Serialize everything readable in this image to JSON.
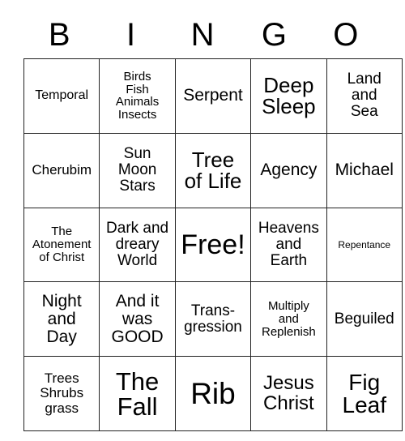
{
  "card": {
    "header_letters": [
      "B",
      "I",
      "N",
      "G",
      "O"
    ],
    "free_space_label": "Free!",
    "grid": [
      [
        {
          "text": "Temporal",
          "size": "fs-sm",
          "free": false
        },
        {
          "text": "Birds\nFish\nAnimals\nInsects",
          "size": "fs-s",
          "free": false
        },
        {
          "text": "Serpent",
          "size": "fs-l",
          "free": false
        },
        {
          "text": "Deep\nSleep",
          "size": "fs-2xl",
          "free": false
        },
        {
          "text": "Land\nand\nSea",
          "size": "fs-ml",
          "free": false
        }
      ],
      [
        {
          "text": "Cherubim",
          "size": "fs-m",
          "free": false
        },
        {
          "text": "Sun\nMoon\nStars",
          "size": "fs-ml",
          "free": false
        },
        {
          "text": "Tree\nof Life",
          "size": "fs-2xl",
          "free": false
        },
        {
          "text": "Agency",
          "size": "fs-l",
          "free": false
        },
        {
          "text": "Michael",
          "size": "fs-l",
          "free": false
        }
      ],
      [
        {
          "text": "The\nAtonement\nof Christ",
          "size": "fs-s",
          "free": false
        },
        {
          "text": "Dark and\ndreary\nWorld",
          "size": "fs-ml",
          "free": false
        },
        {
          "text": "Free!",
          "size": "fs-5xl",
          "free": true
        },
        {
          "text": "Heavens\nand\nEarth",
          "size": "fs-ml",
          "free": false
        },
        {
          "text": "Repentance",
          "size": "fs-xs",
          "free": false
        }
      ],
      [
        {
          "text": "Night\nand\nDay",
          "size": "fs-l",
          "free": false
        },
        {
          "text": "And it\nwas\nGOOD",
          "size": "fs-l",
          "free": false
        },
        {
          "text": "Trans-\ngression",
          "size": "fs-ml",
          "free": false
        },
        {
          "text": "Multiply\nand\nReplenish",
          "size": "fs-s",
          "free": false
        },
        {
          "text": "Beguiled",
          "size": "fs-ml",
          "free": false
        }
      ],
      [
        {
          "text": "Trees\nShrubs\ngrass",
          "size": "fs-m",
          "free": false
        },
        {
          "text": "The\nFall",
          "size": "fs-4xl",
          "free": false
        },
        {
          "text": "Rib",
          "size": "fs-6xl",
          "free": false
        },
        {
          "text": "Jesus\nChrist",
          "size": "fs-xl",
          "free": false
        },
        {
          "text": "Fig\nLeaf",
          "size": "fs-3xl",
          "free": false
        }
      ]
    ]
  },
  "colors": {
    "background": "#ffffff",
    "text": "#000000",
    "border": "#222222"
  }
}
